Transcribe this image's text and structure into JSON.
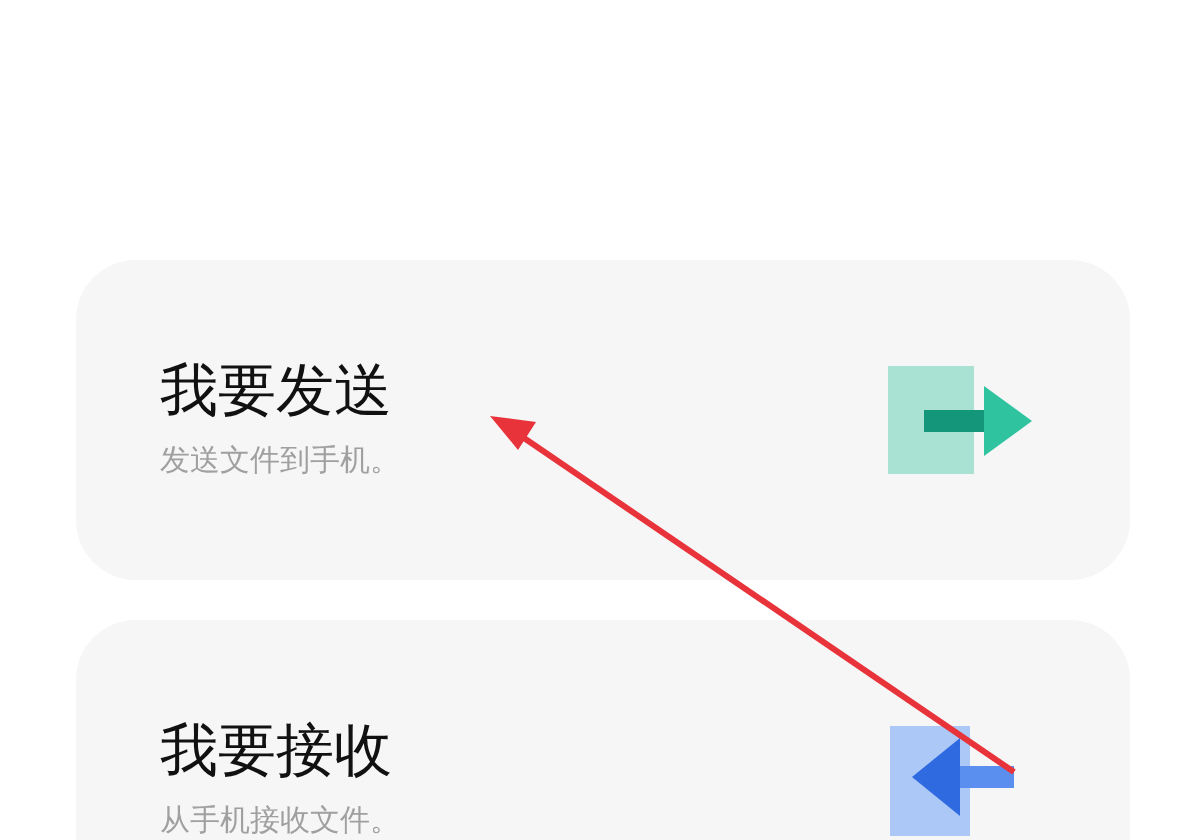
{
  "options": [
    {
      "kind": "send",
      "title": "我要发送",
      "subtitle": "发送文件到手机。"
    },
    {
      "kind": "receive",
      "title": "我要接收",
      "subtitle": "从手机接收文件。"
    }
  ]
}
